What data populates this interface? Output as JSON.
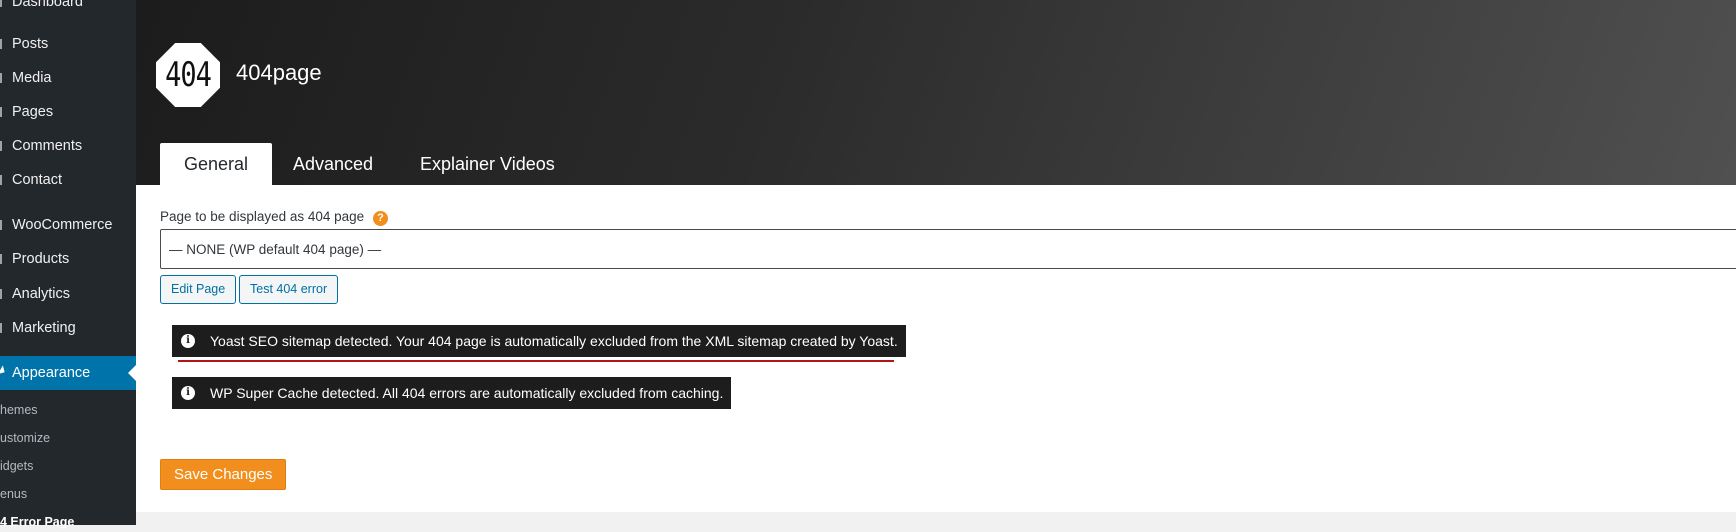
{
  "sidebar": {
    "items": [
      {
        "label": "Dashboard"
      },
      {
        "label": "Posts"
      },
      {
        "label": "Media"
      },
      {
        "label": "Pages"
      },
      {
        "label": "Comments"
      },
      {
        "label": "Contact"
      },
      {
        "label": "WooCommerce"
      },
      {
        "label": "Products"
      },
      {
        "label": "Analytics"
      },
      {
        "label": "Marketing"
      },
      {
        "label": "Appearance"
      }
    ],
    "subitems": [
      {
        "label": "hemes"
      },
      {
        "label": "ustomize"
      },
      {
        "label": "idgets"
      },
      {
        "label": "enus"
      },
      {
        "label": "4 Error Page"
      }
    ]
  },
  "header": {
    "logo_text": "404",
    "title": "404page",
    "tabs": [
      {
        "label": "General"
      },
      {
        "label": "Advanced"
      },
      {
        "label": "Explainer Videos"
      }
    ]
  },
  "form": {
    "field_label": "Page to be displayed as 404 page",
    "help_icon": "?",
    "select_value": "— NONE (WP default 404 page) —",
    "edit_button": "Edit Page",
    "test_button": "Test 404 error"
  },
  "notices": [
    {
      "icon": "i",
      "text": "Yoast SEO sitemap detected. Your 404 page is automatically excluded from the XML sitemap created by Yoast."
    },
    {
      "icon": "i",
      "text": "WP Super Cache detected. All 404 errors are automatically excluded from caching."
    }
  ],
  "save_button": "Save Changes",
  "colors": {
    "sidebar_bg": "#23282d",
    "active_menu": "#0073aa",
    "accent_orange": "#f18e1d",
    "notice_bg": "#1d1d1d",
    "underline_red": "#b3141b"
  }
}
